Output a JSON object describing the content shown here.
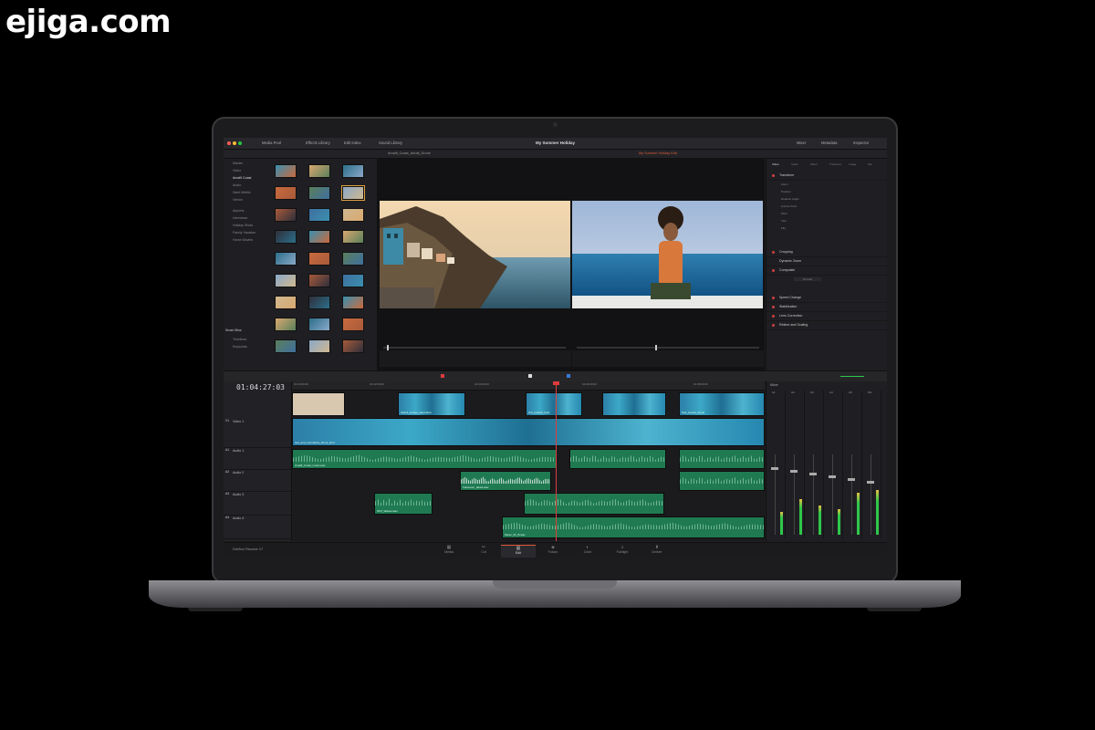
{
  "watermark": "ejiga.com",
  "app": {
    "project_title": "My Summer Holiday",
    "top_left": [
      "Media Pool",
      "Effects Library",
      "Edit Index",
      "Sound Library"
    ],
    "top_right": [
      "Mixer",
      "Metadata",
      "Inspector"
    ],
    "timecode": "01:04:27:03",
    "brand": "DaVinci Resolve 17"
  },
  "media_pool": {
    "tree": [
      "Master",
      "Video",
      "Amalfi Coast",
      "Audio",
      "Saint Mirtillo",
      "Venice",
      "Airports",
      "Interviews",
      "Holiday Shots",
      "Family Vacation",
      "Home Movies"
    ],
    "smart_bins": "Smart Bins",
    "smart_bin_items": [
      "Timelines",
      "Keywords"
    ]
  },
  "viewer": {
    "source_clip": "Amalfi_Coast_Aerial_Drone",
    "timeline_name": "My Summer Holiday Edit"
  },
  "inspector": {
    "tabs": [
      "Video",
      "Audio",
      "Effect",
      "Transition",
      "Image",
      "File"
    ],
    "sections": [
      "Transform",
      "Cropping",
      "Dynamic Zoom",
      "Composite",
      "Speed Change",
      "Stabilization",
      "Lens Correction",
      "Retime and Scaling"
    ],
    "params": [
      "Zoom",
      "Position",
      "Rotation Angle",
      "Anchor Point",
      "Pitch",
      "Yaw",
      "Flip"
    ],
    "composite_mode": "Normal"
  },
  "timeline": {
    "ruler": [
      "01:00:00:00",
      "01:02:00:00",
      "01:04:00:00",
      "01:06:00:00",
      "01:08:00:00"
    ],
    "tracks": [
      {
        "tag": "V1",
        "name": "Video 1"
      },
      {
        "tag": "A1",
        "name": "Audio 1"
      },
      {
        "tag": "A2",
        "name": "Audio 2"
      },
      {
        "tag": "A3",
        "name": "Audio 3"
      },
      {
        "tag": "A4",
        "name": "Audio 4"
      }
    ],
    "clips": {
      "v2_a": "Island_sunset_panorama",
      "v2_b": "Girl_portrait_boat",
      "v2_c": "Sea_sunset_drone",
      "v1": "sea_and_mountains_drone_shot",
      "a1": "Amalfi_Coast_music.wav",
      "a2": "Voiceover_take2.wav",
      "a3": "SFX_Waves.wav",
      "a4": "Music_01_B.wav"
    }
  },
  "mixer": {
    "title": "Mixer",
    "channels": [
      "A1",
      "A2",
      "A3",
      "A4",
      "A5",
      "M1"
    ]
  },
  "pages": [
    {
      "icon": "▦",
      "label": "Media"
    },
    {
      "icon": "✂",
      "label": "Cut"
    },
    {
      "icon": "▥",
      "label": "Edit"
    },
    {
      "icon": "◈",
      "label": "Fusion"
    },
    {
      "icon": "◐",
      "label": "Color"
    },
    {
      "icon": "♫",
      "label": "Fairlight"
    },
    {
      "icon": "⬆",
      "label": "Deliver"
    }
  ],
  "colors": {
    "accent_red": "#e03c3c",
    "video_clip": "#2c7fa8",
    "audio_clip": "#1f7a52",
    "meter": "#2ec74a"
  }
}
